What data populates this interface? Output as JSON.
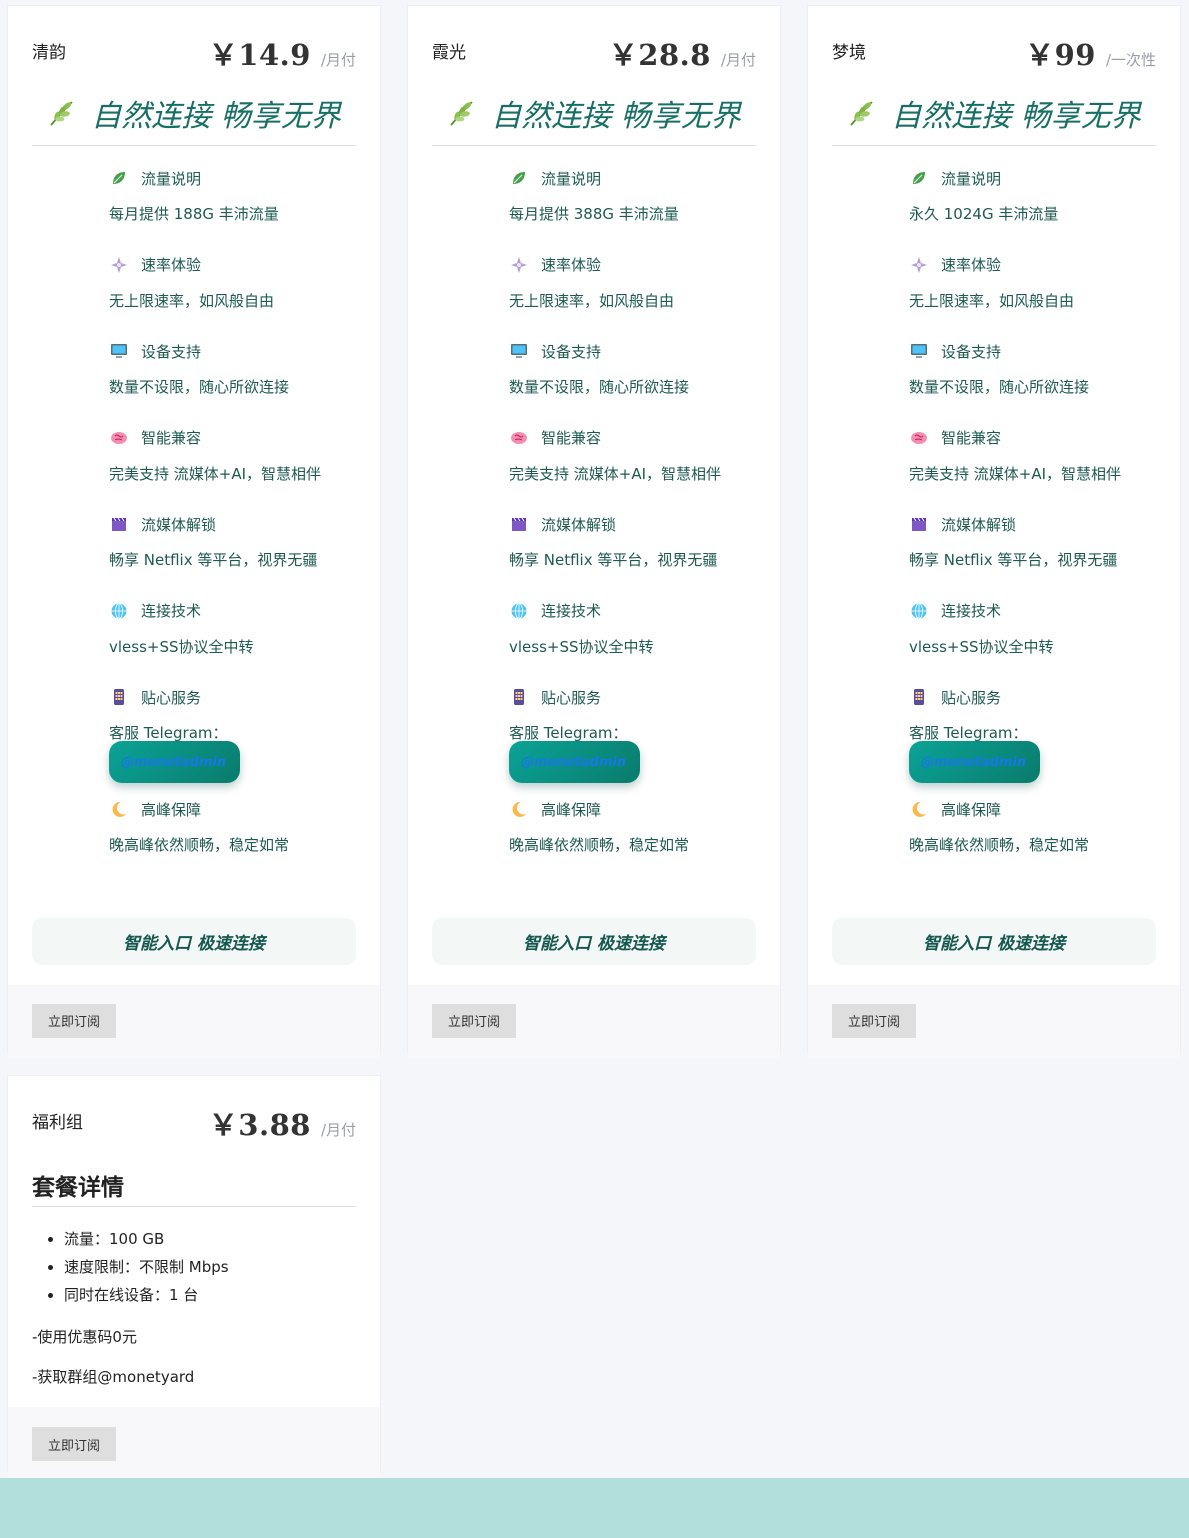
{
  "colors": {
    "accent": "#186f65",
    "band": "#b2dfdb",
    "telegram_btn": "#0a8f82"
  },
  "plans": [
    {
      "name": "清韵",
      "price": "￥14.9",
      "period": "/月付",
      "slogan": "自然连接 畅享无界",
      "features": [
        {
          "icon": "leaf-icon",
          "title": "流量说明",
          "desc": "每月提供 188G 丰沛流量"
        },
        {
          "icon": "sparkle-icon",
          "title": "速率体验",
          "desc": "无上限速率，如风般自由"
        },
        {
          "icon": "monitor-icon",
          "title": "设备支持",
          "desc": "数量不设限，随心所欲连接"
        },
        {
          "icon": "brain-icon",
          "title": "智能兼容",
          "desc": "完美支持 流媒体+AI，智慧相伴"
        },
        {
          "icon": "clapper-icon",
          "title": "流媒体解锁",
          "desc": "畅享 Netflix 等平台，视界无疆"
        },
        {
          "icon": "globe-icon",
          "title": "连接技术",
          "desc": "vless+SS协议全中转"
        }
      ],
      "service": {
        "icon": "phone-icon",
        "title": "贴心服务",
        "label": "客服 Telegram：",
        "handle": "@monetadmin"
      },
      "peak": {
        "icon": "moon-icon",
        "title": "高峰保障",
        "desc": "晚高峰依然顺畅，稳定如常"
      },
      "cta": "智能入口 极速连接",
      "subscribe": "立即订阅"
    },
    {
      "name": "霞光",
      "price": "￥28.8",
      "period": "/月付",
      "slogan": "自然连接 畅享无界",
      "features": [
        {
          "icon": "leaf-icon",
          "title": "流量说明",
          "desc": "每月提供 388G 丰沛流量"
        },
        {
          "icon": "sparkle-icon",
          "title": "速率体验",
          "desc": "无上限速率，如风般自由"
        },
        {
          "icon": "monitor-icon",
          "title": "设备支持",
          "desc": "数量不设限，随心所欲连接"
        },
        {
          "icon": "brain-icon",
          "title": "智能兼容",
          "desc": "完美支持 流媒体+AI，智慧相伴"
        },
        {
          "icon": "clapper-icon",
          "title": "流媒体解锁",
          "desc": "畅享 Netflix 等平台，视界无疆"
        },
        {
          "icon": "globe-icon",
          "title": "连接技术",
          "desc": "vless+SS协议全中转"
        }
      ],
      "service": {
        "icon": "phone-icon",
        "title": "贴心服务",
        "label": "客服 Telegram：",
        "handle": "@monetadmin"
      },
      "peak": {
        "icon": "moon-icon",
        "title": "高峰保障",
        "desc": "晚高峰依然顺畅，稳定如常"
      },
      "cta": "智能入口 极速连接",
      "subscribe": "立即订阅"
    },
    {
      "name": "梦境",
      "price": "￥99",
      "period": "/一次性",
      "slogan": "自然连接 畅享无界",
      "features": [
        {
          "icon": "leaf-icon",
          "title": "流量说明",
          "desc": "永久 1024G 丰沛流量"
        },
        {
          "icon": "sparkle-icon",
          "title": "速率体验",
          "desc": "无上限速率，如风般自由"
        },
        {
          "icon": "monitor-icon",
          "title": "设备支持",
          "desc": "数量不设限，随心所欲连接"
        },
        {
          "icon": "brain-icon",
          "title": "智能兼容",
          "desc": "完美支持 流媒体+AI，智慧相伴"
        },
        {
          "icon": "clapper-icon",
          "title": "流媒体解锁",
          "desc": "畅享 Netflix 等平台，视界无疆"
        },
        {
          "icon": "globe-icon",
          "title": "连接技术",
          "desc": "vless+SS协议全中转"
        }
      ],
      "service": {
        "icon": "phone-icon",
        "title": "贴心服务",
        "label": "客服 Telegram：",
        "handle": "@monetadmin"
      },
      "peak": {
        "icon": "moon-icon",
        "title": "高峰保障",
        "desc": "晚高峰依然顺畅，稳定如常"
      },
      "cta": "智能入口 极速连接",
      "subscribe": "立即订阅"
    }
  ],
  "welfare": {
    "name": "福利组",
    "price": "￥3.88",
    "period": "/月付",
    "detail_title": "套餐详情",
    "items": [
      "流量：100 GB",
      "速度限制：不限制 Mbps",
      "同时在线设备：1 台"
    ],
    "notes": [
      "-使用优惠码0元",
      "-获取群组@monetyard"
    ],
    "subscribe": "立即订阅"
  }
}
